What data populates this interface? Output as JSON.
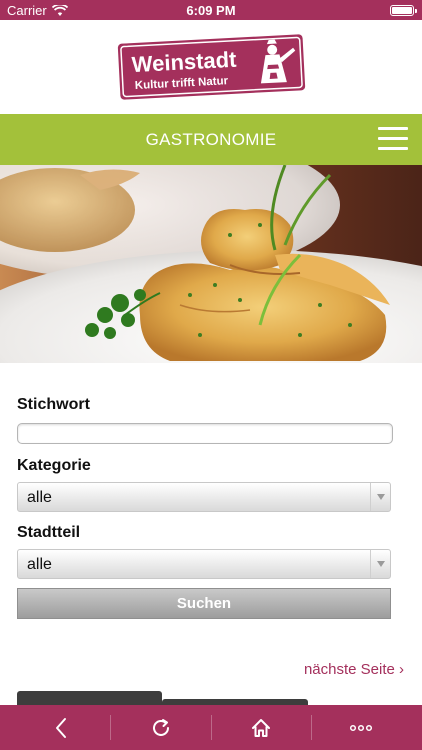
{
  "status_bar": {
    "carrier": "Carrier",
    "time": "6:09 PM"
  },
  "logo": {
    "name": "Weinstadt",
    "tagline": "Kultur trifft Natur"
  },
  "nav": {
    "title": "GASTRONOMIE",
    "menu_icon": "hamburger-menu-icon"
  },
  "hero": {
    "image": "food-photo"
  },
  "form": {
    "keyword_label": "Stichwort",
    "keyword_value": "",
    "category_label": "Kategorie",
    "category_value": "alle",
    "district_label": "Stadtteil",
    "district_value": "alle",
    "search_button": "Suchen"
  },
  "pagination": {
    "next": "nächste Seite ›"
  },
  "toolbar": {
    "items": [
      "back-icon",
      "reload-icon",
      "home-icon",
      "more-icon"
    ]
  },
  "colors": {
    "brand": "#a4305c",
    "nav_green": "#a3c13a"
  }
}
